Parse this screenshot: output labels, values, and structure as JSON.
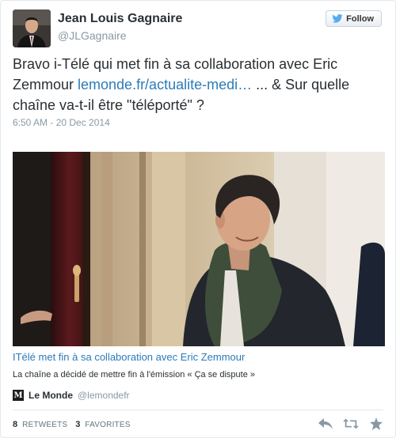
{
  "author": {
    "name": "Jean Louis Gagnaire",
    "handle": "@JLGagnaire"
  },
  "follow_button": {
    "label": "Follow",
    "icon": "twitter-bird-icon"
  },
  "tweet": {
    "text_before_link": "Bravo i-Télé qui met fin à sa collaboration avec Eric Zemmour ",
    "link_text": "lemonde.fr/actualite-medi…",
    "text_after_link": " ... &  Sur quelle chaîne va-t-il être \"téléporté\" ?",
    "timestamp": "6:50 AM - 20 Dec 2014"
  },
  "card": {
    "title": "ITélé met fin à sa collaboration avec Eric Zemmour",
    "description": "La chaîne a décidé de mettre fin à l'émission « Ça se dispute »",
    "source_logo_letter": "M",
    "source_name": "Le Monde",
    "source_handle": "@lemondefr"
  },
  "stats": {
    "retweets_count": "8",
    "retweets_label": "RETWEETS",
    "favorites_count": "3",
    "favorites_label": "FAVORITES"
  },
  "actions": [
    "reply-icon",
    "retweet-icon",
    "favorite-icon"
  ],
  "colors": {
    "link": "#2b7bb9",
    "muted": "#8899a6",
    "text": "#292f33",
    "action_icon": "#8899a6"
  }
}
